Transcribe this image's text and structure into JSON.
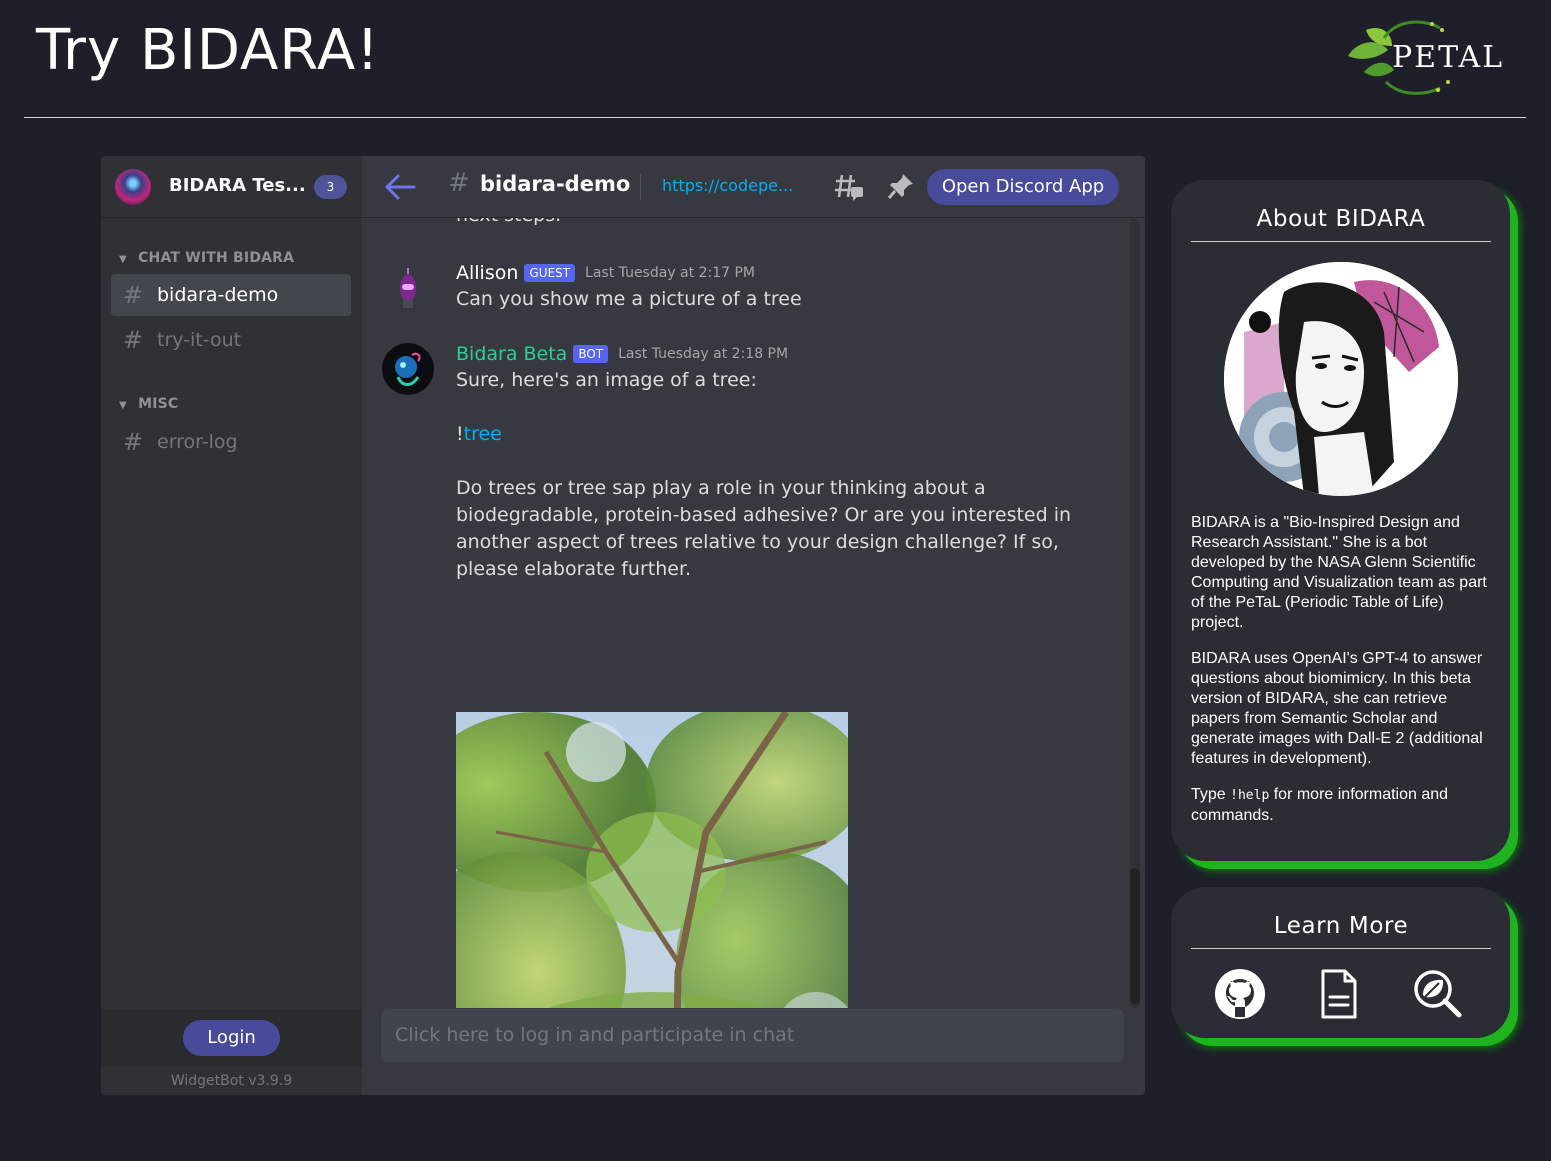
{
  "page": {
    "title": "Try BIDARA!",
    "logo_text": "PETAL"
  },
  "sidebar": {
    "server_name": "BIDARA Tes...",
    "server_badge": "3",
    "categories": [
      {
        "label": "CHAT WITH BIDARA"
      },
      {
        "label": "MISC"
      }
    ],
    "channels": [
      {
        "label": "bidara-demo",
        "active": true
      },
      {
        "label": "try-it-out",
        "active": false
      },
      {
        "label": "error-log",
        "active": false
      }
    ],
    "login_label": "Login",
    "footer": "WidgetBot v3.9.9"
  },
  "chat_header": {
    "channel_name": "bidara-demo",
    "link_text": "https://codepe...",
    "open_button": "Open Discord App"
  },
  "messages": {
    "cut_off_text": "next steps.",
    "items": [
      {
        "author": "Allison",
        "tag": "GUEST",
        "timestamp": "Last Tuesday at 2:17 PM",
        "text": "Can you show me a picture of a tree"
      },
      {
        "author": "Bidara Beta",
        "tag": "BOT",
        "timestamp": "Last Tuesday at 2:18 PM",
        "line1": "Sure, here's an image of a tree:",
        "command_prefix": "!",
        "command_link": "tree",
        "paragraph": "Do trees or tree sap play a role in your thinking about a biodegradable, protein-based adhesive? Or are you interested in another aspect of trees relative to your design challenge? If so, please elaborate further."
      }
    ]
  },
  "chat_input": {
    "placeholder": "Click here to log in and participate in chat"
  },
  "about": {
    "title": "About BIDARA",
    "p1": "BIDARA is a \"Bio-Inspired Design and Research Assistant.\" She is a bot developed by the NASA Glenn Scientific Computing and Visualization team as part of the PeTaL (Periodic Table of Life) project.",
    "p2": "BIDARA uses OpenAI's GPT-4 to answer questions about biomimicry. In this beta version of BIDARA, she can retrieve papers from Semantic Scholar and generate images with Dall-E 2 (additional features in development).",
    "p3_before": "Type ",
    "p3_code": "!help",
    "p3_after": " for more information and commands."
  },
  "learn_more": {
    "title": "Learn More",
    "icons": [
      "github-icon",
      "document-icon",
      "search-leaf-icon"
    ]
  },
  "colors": {
    "background": "#1e1f29",
    "accent_blurple": "#474b9a",
    "bot_name": "#2ecc9a",
    "link": "#00aff4",
    "card_glow": "#1fb41f"
  }
}
